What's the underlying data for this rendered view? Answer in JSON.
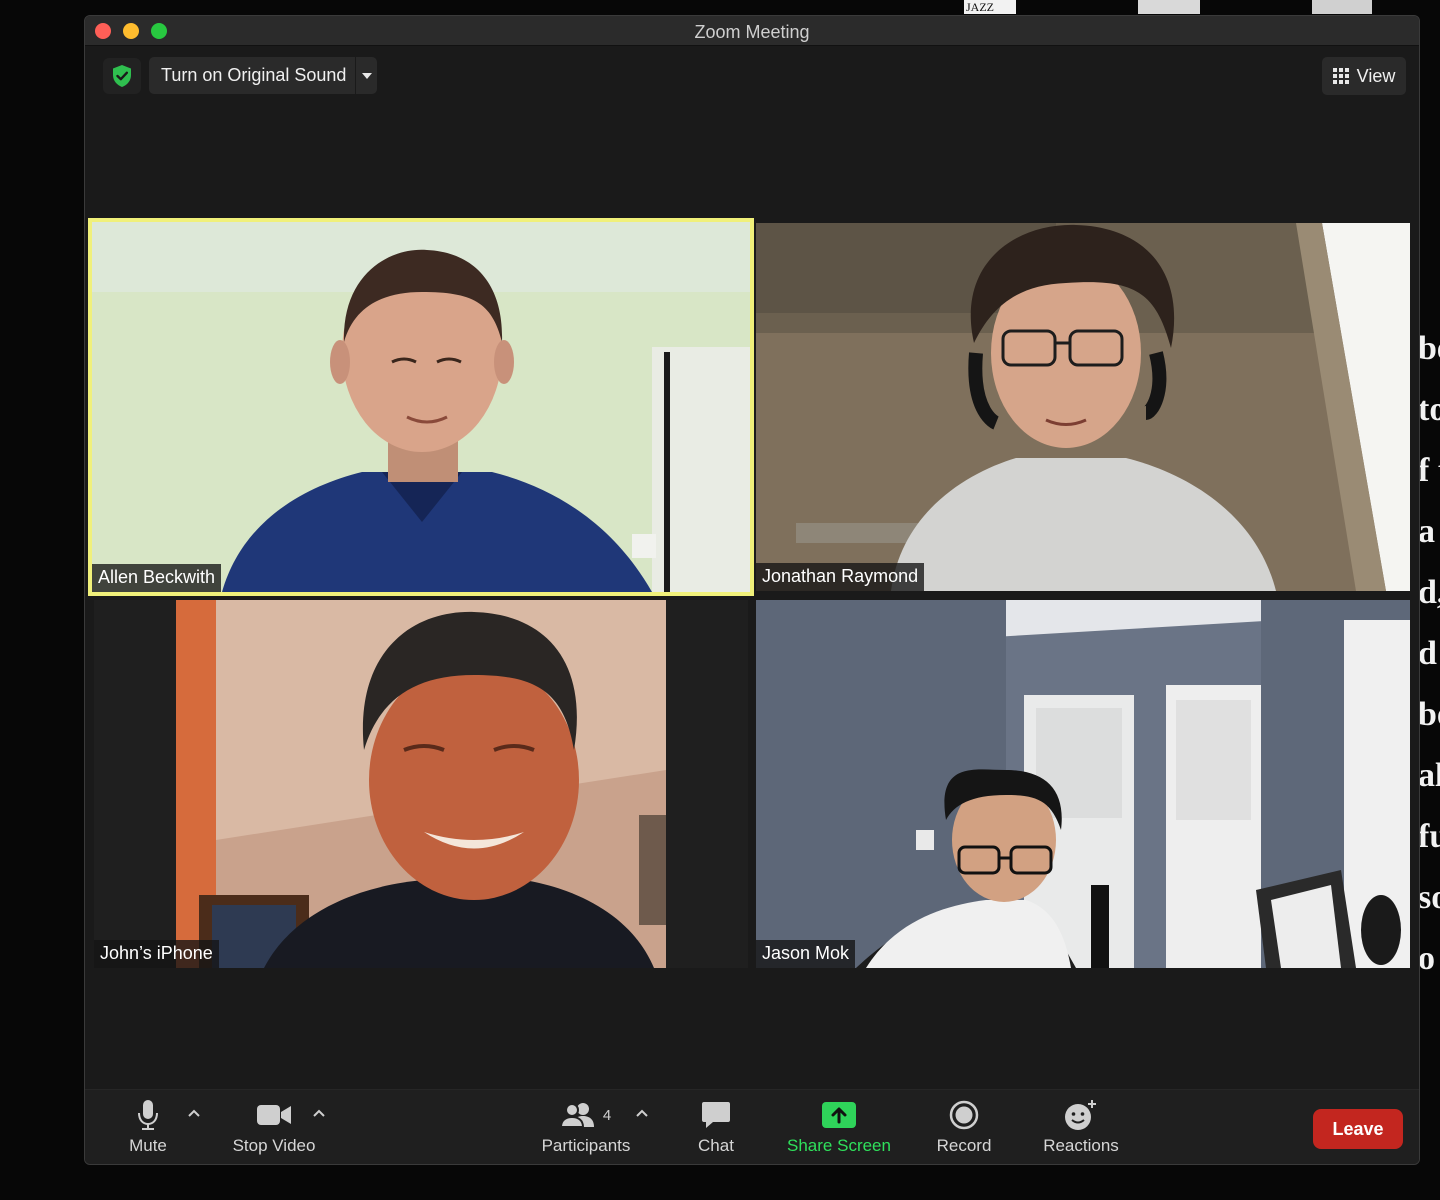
{
  "window": {
    "title": "Zoom Meeting"
  },
  "desktop": {
    "strip_text": "JAZZ TIM",
    "side_letters": [
      "be",
      "to",
      "f t",
      "a",
      "d,",
      "d",
      "bo",
      "al",
      "fu",
      "so",
      "o"
    ]
  },
  "topbar": {
    "original_sound_label": "Turn on Original Sound",
    "view_label": "View",
    "security_icon": "shield-check-icon"
  },
  "participants": [
    {
      "name": "Allen Beckwith",
      "speaking": true
    },
    {
      "name": "Jonathan Raymond",
      "speaking": false
    },
    {
      "name": "John’s iPhone",
      "speaking": false
    },
    {
      "name": "Jason Mok",
      "speaking": false
    }
  ],
  "toolbar": {
    "mute_label": "Mute",
    "stop_video_label": "Stop Video",
    "participants_label": "Participants",
    "participants_count": "4",
    "chat_label": "Chat",
    "share_screen_label": "Share Screen",
    "record_label": "Record",
    "reactions_label": "Reactions",
    "leave_label": "Leave"
  },
  "colors": {
    "active_speaker_border": "#f0f07a",
    "share_green": "#2fe05b",
    "leave_red": "#c3261f"
  }
}
